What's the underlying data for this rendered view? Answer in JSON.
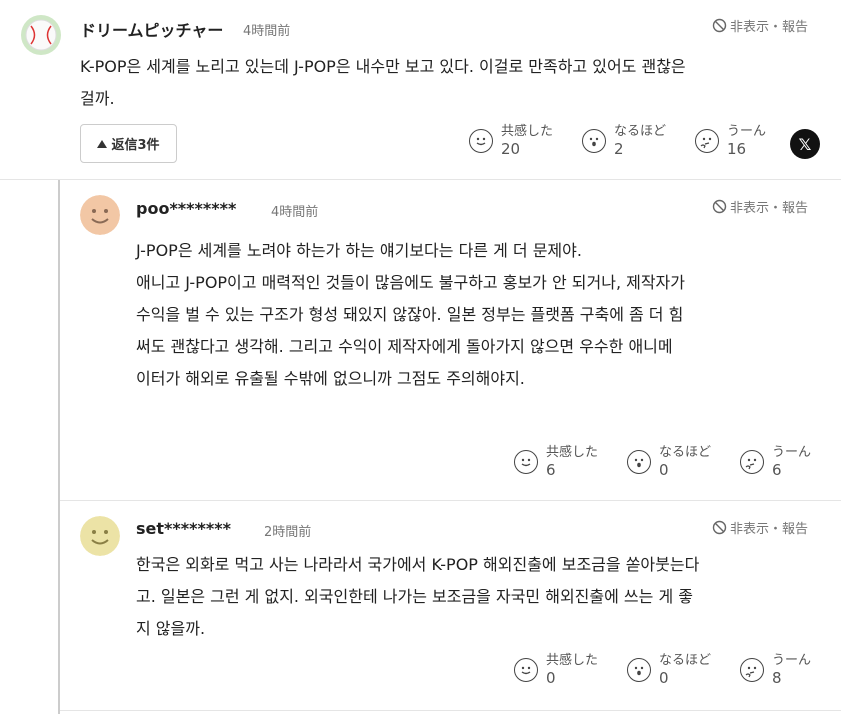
{
  "hide_report_label": "非表示・報告",
  "reaction_labels": {
    "empathy": "共感した",
    "naruhodo": "なるほど",
    "uun": "うーん"
  },
  "main_comment": {
    "username": "ドリームピッチャー",
    "time": "4時間前",
    "text_lines": [
      "K-POP은 세계를 노리고 있는데 J-POP은 내수만 보고 있다. 이걸로 만족하고 있어도 괜찮은",
      "걸까."
    ],
    "reply_button": "返信3件",
    "reactions": {
      "empathy": "20",
      "naruhodo": "2",
      "uun": "16"
    },
    "share_icon": "x-logo"
  },
  "replies": [
    {
      "username": "poo********",
      "time": "4時間前",
      "avatar_color": "#f2c7a5",
      "text_lines": [
        "J-POP은 세계를 노려야 하는가 하는 얘기보다는 다른 게 더 문제야.",
        "애니고 J-POP이고 매력적인 것들이 많음에도 불구하고 홍보가 안 되거나, 제작자가",
        "수익을 벌 수 있는 구조가 형성 돼있지 않잖아. 일본 정부는 플랫폼 구축에 좀 더 힘",
        "써도 괜찮다고 생각해. 그리고 수익이 제작자에게 돌아가지 않으면 우수한 애니메",
        "이터가 해외로 유출될 수밖에 없으니까 그점도 주의해야지."
      ],
      "reactions": {
        "empathy": "6",
        "naruhodo": "0",
        "uun": "6"
      }
    },
    {
      "username": "set********",
      "time": "2時間前",
      "avatar_color": "#ece3a6",
      "text_lines": [
        "한국은 외화로 먹고 사는 나라라서 국가에서 K-POP 해외진출에 보조금을 쏟아붓는다",
        "고. 일본은 그런 게 없지. 외국인한테 나가는 보조금을 자국민 해외진출에 쓰는 게 좋",
        "지 않을까."
      ],
      "reactions": {
        "empathy": "0",
        "naruhodo": "0",
        "uun": "8"
      }
    }
  ]
}
